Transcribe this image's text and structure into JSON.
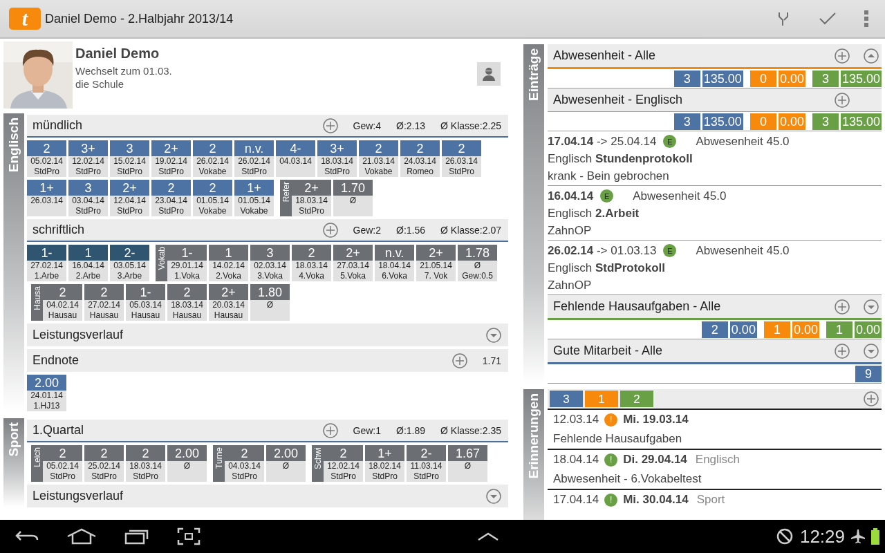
{
  "app_bar": {
    "logo_letter": "t",
    "title": "Daniel Demo - 2.Halbjahr 2013/14"
  },
  "profile": {
    "name": "Daniel Demo",
    "note": [
      "Wechselt zum 01.03.",
      "die Schule"
    ]
  },
  "subjects": [
    {
      "name": "Englisch",
      "sections": [
        {
          "kind": "grades",
          "title": "mündlich",
          "stats": [
            "Gew:4",
            "Ø:2.13",
            "Ø Klasse:2.25"
          ],
          "items": [
            {
              "kind": "tile",
              "grade": "2",
              "color": "#4d72a4",
              "lines": [
                "05.02.14",
                "StdPro"
              ]
            },
            {
              "kind": "tile",
              "grade": "3+",
              "color": "#4d72a4",
              "lines": [
                "12.02.14",
                "StdPro"
              ]
            },
            {
              "kind": "tile",
              "grade": "3",
              "color": "#4d72a4",
              "lines": [
                "15.02.14",
                "StdPro"
              ]
            },
            {
              "kind": "tile",
              "grade": "2+",
              "color": "#4d72a4",
              "lines": [
                "19.02.14",
                "StdPro"
              ]
            },
            {
              "kind": "tile",
              "grade": "2",
              "color": "#4d72a4",
              "lines": [
                "26.02.14",
                "Vokabe"
              ]
            },
            {
              "kind": "tile",
              "grade": "n.v.",
              "color": "#4d72a4",
              "lines": [
                "26.02.14",
                "StdPro"
              ]
            },
            {
              "kind": "tile",
              "grade": "4-",
              "color": "#4d72a4",
              "lines": [
                "04.03.14"
              ]
            },
            {
              "kind": "tile",
              "grade": "3+",
              "color": "#4d72a4",
              "lines": [
                "18.03.14",
                "StdPro"
              ]
            },
            {
              "kind": "tile",
              "grade": "2",
              "color": "#4d72a4",
              "lines": [
                "21.03.14",
                "Vokabe"
              ]
            },
            {
              "kind": "tile",
              "grade": "2",
              "color": "#4d72a4",
              "lines": [
                "24.03.14",
                "Romeo"
              ]
            },
            {
              "kind": "tile",
              "grade": "2",
              "color": "#4d72a4",
              "lines": [
                "26.03.14",
                "StdPro"
              ]
            },
            {
              "kind": "tile",
              "grade": "1+",
              "color": "#4d72a4",
              "lines": [
                "26.03.14"
              ]
            },
            {
              "kind": "tile",
              "grade": "3",
              "color": "#4d72a4",
              "lines": [
                "03.04.14",
                "StdPro"
              ]
            },
            {
              "kind": "tile",
              "grade": "2+",
              "color": "#4d72a4",
              "lines": [
                "12.04.14",
                "StdPro"
              ]
            },
            {
              "kind": "tile",
              "grade": "2",
              "color": "#4d72a4",
              "lines": [
                "23.04.14",
                "StdPro"
              ]
            },
            {
              "kind": "tile",
              "grade": "2",
              "color": "#4d72a4",
              "lines": [
                "01.05.14",
                "Vokabe"
              ]
            },
            {
              "kind": "tile",
              "grade": "1+",
              "color": "#4d72a4",
              "lines": [
                "01.05.14",
                "Vokabe"
              ]
            },
            {
              "kind": "group",
              "label": "Refer",
              "tiles": [
                {
                  "grade": "2+",
                  "color": "#6b6f74",
                  "lines": [
                    "18.03.14",
                    "StdPro"
                  ]
                },
                {
                  "grade": "1.70",
                  "color": "#6b6f74",
                  "lines": [
                    "Ø"
                  ]
                }
              ]
            }
          ]
        },
        {
          "kind": "grades",
          "title": "schriftlich",
          "stats": [
            "Gew:2",
            "Ø:1.56",
            "Ø Klasse:2.07"
          ],
          "items": [
            {
              "kind": "tile",
              "grade": "1-",
              "color": "#2f5571",
              "lines": [
                "27.02.14",
                "1.Arbe"
              ]
            },
            {
              "kind": "tile",
              "grade": "1",
              "color": "#2f5571",
              "lines": [
                "16.04.14",
                "2.Arbe"
              ]
            },
            {
              "kind": "tile",
              "grade": "2-",
              "color": "#2f5571",
              "lines": [
                "03.05.14",
                "3.Arbe"
              ]
            },
            {
              "kind": "group",
              "label": "Vokab",
              "tiles": [
                {
                  "grade": "1-",
                  "color": "#6b6f74",
                  "lines": [
                    "29.01.14",
                    "1.Voka"
                  ]
                },
                {
                  "grade": "1",
                  "color": "#6b6f74",
                  "lines": [
                    "14.02.14",
                    "2.Voka"
                  ]
                },
                {
                  "grade": "3",
                  "color": "#6b6f74",
                  "lines": [
                    "02.03.14",
                    "3.Voka"
                  ]
                },
                {
                  "grade": "2",
                  "color": "#6b6f74",
                  "lines": [
                    "18.03.14",
                    "4.Voka"
                  ]
                },
                {
                  "grade": "2+",
                  "color": "#6b6f74",
                  "lines": [
                    "27.03.14",
                    "5.Voka"
                  ]
                },
                {
                  "grade": "n.v.",
                  "color": "#6b6f74",
                  "lines": [
                    "18.04.14",
                    "6.Voka"
                  ]
                },
                {
                  "grade": "2+",
                  "color": "#6b6f74",
                  "lines": [
                    "21.05.14",
                    "7. Vok"
                  ]
                },
                {
                  "grade": "1.78",
                  "color": "#6b6f74",
                  "lines": [
                    "Ø",
                    "Gew:0.5"
                  ]
                }
              ]
            },
            {
              "kind": "group",
              "label": "Hausa",
              "tiles": [
                {
                  "grade": "2",
                  "color": "#6b6f74",
                  "lines": [
                    "04.02.14",
                    "Hausau"
                  ]
                },
                {
                  "grade": "2",
                  "color": "#6b6f74",
                  "lines": [
                    "27.02.14",
                    "Hausau"
                  ]
                },
                {
                  "grade": "1-",
                  "color": "#6b6f74",
                  "lines": [
                    "05.03.14",
                    "Hausau"
                  ]
                },
                {
                  "grade": "2",
                  "color": "#6b6f74",
                  "lines": [
                    "18.03.14",
                    "Hausau"
                  ]
                },
                {
                  "grade": "2+",
                  "color": "#6b6f74",
                  "lines": [
                    "20.03.14",
                    "Hausau"
                  ]
                },
                {
                  "grade": "1.80",
                  "color": "#6b6f74",
                  "lines": [
                    "Ø"
                  ]
                }
              ]
            }
          ]
        },
        {
          "kind": "collapsed",
          "title": "Leistungsverlauf"
        },
        {
          "kind": "final",
          "title": "Endnote",
          "value": "1.71",
          "items": [
            {
              "kind": "tile",
              "grade": "2.00",
              "color": "#4d72a4",
              "lines": [
                "24.01.14",
                "1.HJ13"
              ]
            }
          ]
        }
      ]
    },
    {
      "name": "Sport",
      "sections": [
        {
          "kind": "grades",
          "title": "1.Quartal",
          "stats": [
            "Gew:1",
            "Ø:1.89",
            "Ø Klasse:2.35"
          ],
          "items": [
            {
              "kind": "group",
              "label": "Leich",
              "tiles": [
                {
                  "grade": "2",
                  "color": "#6b6f74",
                  "lines": [
                    "05.02.14",
                    "StdPro"
                  ]
                },
                {
                  "grade": "2",
                  "color": "#6b6f74",
                  "lines": [
                    "25.02.14",
                    "StdPro"
                  ]
                },
                {
                  "grade": "2",
                  "color": "#6b6f74",
                  "lines": [
                    "18.03.14",
                    "StdPro"
                  ]
                },
                {
                  "grade": "2.00",
                  "color": "#6b6f74",
                  "lines": [
                    "Ø"
                  ]
                }
              ]
            },
            {
              "kind": "group",
              "label": "Turne",
              "tiles": [
                {
                  "grade": "2",
                  "color": "#6b6f74",
                  "lines": [
                    "04.03.14",
                    "StdPro"
                  ]
                },
                {
                  "grade": "2.00",
                  "color": "#6b6f74",
                  "lines": [
                    "Ø"
                  ]
                }
              ]
            },
            {
              "kind": "group",
              "label": "Schwi",
              "tiles": [
                {
                  "grade": "2",
                  "color": "#6b6f74",
                  "lines": [
                    "12.02.14",
                    "StdPro"
                  ]
                },
                {
                  "grade": "1+",
                  "color": "#6b6f74",
                  "lines": [
                    "18.02.14",
                    "StdPro"
                  ]
                },
                {
                  "grade": "2-",
                  "color": "#6b6f74",
                  "lines": [
                    "11.03.14",
                    "StdPro"
                  ]
                },
                {
                  "grade": "1.67",
                  "color": "#6b6f74",
                  "lines": [
                    "Ø"
                  ]
                }
              ]
            }
          ]
        },
        {
          "kind": "collapsed",
          "title": "Leistungsverlauf"
        }
      ]
    }
  ],
  "entries": {
    "label": "Einträge",
    "items": [
      {
        "kind": "summary",
        "title": "Abwesenheit - Alle",
        "color": "#f28a10",
        "expanded": true,
        "counts": [
          {
            "value": "3",
            "color": "#4d72a4"
          },
          {
            "value": "135.00",
            "color": "#4d72a4"
          },
          {
            "value": "0",
            "color": "#f7890c"
          },
          {
            "value": "0.00",
            "color": "#f7890c"
          },
          {
            "value": "3",
            "color": "#69a046"
          },
          {
            "value": "135.00",
            "color": "#69a046"
          }
        ]
      },
      {
        "kind": "summary",
        "title": "Abwesenheit - Englisch",
        "counts": [
          {
            "value": "3",
            "color": "#4d72a4"
          },
          {
            "value": "135.00",
            "color": "#4d72a4"
          },
          {
            "value": "0",
            "color": "#f7890c"
          },
          {
            "value": "0.00",
            "color": "#f7890c"
          },
          {
            "value": "3",
            "color": "#69a046"
          },
          {
            "value": "135.00",
            "color": "#69a046"
          }
        ]
      },
      {
        "kind": "entry",
        "dates": "**17.04.14** -> 25.04.14",
        "badge": "E",
        "color": "#69a046",
        "info": "Abwesenheit 45.0",
        "title": "Englisch **Stundenprotokoll**",
        "note": "krank - Bein gebrochen"
      },
      {
        "kind": "entry",
        "dates": "**16.04.14**",
        "badge": "E",
        "color": "#69a046",
        "info": "Abwesenheit 45.0",
        "title": "Englisch **2.Arbeit**",
        "note": "ZahnOP"
      },
      {
        "kind": "entry",
        "dates": "**26.02.14** -> 01.03.13",
        "badge": "E",
        "color": "#69a046",
        "info": "Abwesenheit 45.0",
        "title": "Englisch **StdProtokoll**",
        "note": "ZahnOP"
      },
      {
        "kind": "summary",
        "title": "Fehlende Hausaufgaben - Alle",
        "color": "#69a046",
        "expanded": false,
        "counts": [
          {
            "value": "2",
            "color": "#4d72a4"
          },
          {
            "value": "0.00",
            "color": "#4d72a4"
          },
          {
            "value": "1",
            "color": "#f7890c"
          },
          {
            "value": "0.00",
            "color": "#f7890c"
          },
          {
            "value": "1",
            "color": "#69a046"
          },
          {
            "value": "0.00",
            "color": "#69a046"
          }
        ]
      },
      {
        "kind": "summary",
        "title": "Gute Mitarbeit - Alle",
        "color": "#4d6f9c",
        "expanded": false,
        "counts": [
          {
            "value": "9",
            "color": "#4d72a4"
          }
        ]
      }
    ]
  },
  "reminders": {
    "label": "Erinnerungen",
    "counts": [
      {
        "value": "3",
        "color": "#4d72a4"
      },
      {
        "value": "1",
        "color": "#f7890c"
      },
      {
        "value": "2",
        "color": "#69a046"
      }
    ],
    "items": [
      {
        "created": "12.03.14",
        "mark": "!",
        "color": "#f7890c",
        "due": "Mi. 19.03.14",
        "text": "Fehlende Hausaufgaben"
      },
      {
        "created": "18.04.14",
        "mark": "!",
        "color": "#69a046",
        "due": "Di. 29.04.14",
        "subject": "Englisch",
        "text": "Abwesenheit - 6.Vokabeltest"
      },
      {
        "created": "17.04.14",
        "mark": "!",
        "color": "#69a046",
        "due": "Mi. 30.04.14",
        "subject": "Sport"
      }
    ]
  },
  "nav_bar": {
    "clock": "12:29"
  }
}
